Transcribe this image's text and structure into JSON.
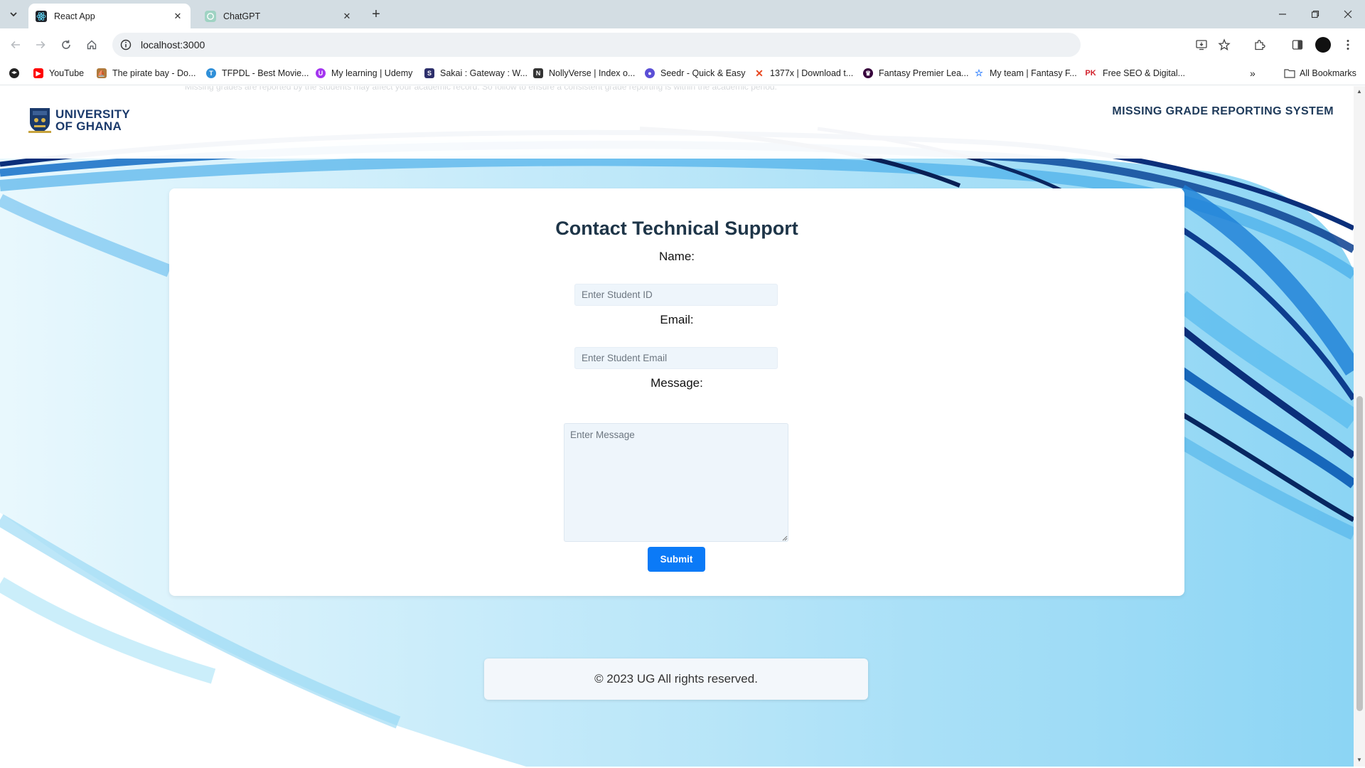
{
  "browser": {
    "tabs": [
      {
        "title": "React App",
        "favicon": "react-icon",
        "active": true
      },
      {
        "title": "ChatGPT",
        "favicon": "chatgpt-icon",
        "active": false
      }
    ],
    "url": "localhost:3000",
    "bookmarks": [
      {
        "label": "YouTube",
        "icon": "youtube-icon",
        "color": "#ff0000"
      },
      {
        "label": "The pirate bay - Do...",
        "icon": "pirate-ship-icon",
        "color": "#b07a3c"
      },
      {
        "label": "TFPDL - Best Movie...",
        "icon": "tfpdl-icon",
        "color": "#2f8fd8"
      },
      {
        "label": "My learning | Udemy",
        "icon": "udemy-icon",
        "color": "#a435f0"
      },
      {
        "label": "Sakai : Gateway : W...",
        "icon": "sakai-icon",
        "color": "#2d2f6b"
      },
      {
        "label": "NollyVerse | Index o...",
        "icon": "nollyverse-icon",
        "color": "#333333"
      },
      {
        "label": "Seedr - Quick & Easy",
        "icon": "seedr-icon",
        "color": "#5b4fd6"
      },
      {
        "label": "1377x | Download t...",
        "icon": "x-icon",
        "color": "#e8471f"
      },
      {
        "label": "Fantasy Premier Lea...",
        "icon": "premier-league-icon",
        "color": "#37003c"
      },
      {
        "label": "My team | Fantasy F...",
        "icon": "fantasy-star-icon",
        "color": "#3a86ff"
      },
      {
        "label": "Free SEO & Digital...",
        "icon": "pk-icon",
        "color": "#d11f2a"
      }
    ],
    "all_bookmarks_label": "All Bookmarks"
  },
  "header": {
    "logo_line1": "UNIVERSITY",
    "logo_line2": "OF GHANA",
    "system_title": "MISSING GRADE REPORTING SYSTEM",
    "ghost_text": "Missing grades are reported by the students may affect your academic record. So follow to ensure a consistent grade reporting is within the academic period."
  },
  "form": {
    "title": "Contact Technical Support",
    "name_label": "Name:",
    "name_placeholder": "Enter Student ID",
    "email_label": "Email:",
    "email_placeholder": "Enter Student Email",
    "message_label": "Message:",
    "message_placeholder": "Enter Message",
    "submit_label": "Submit"
  },
  "footer": {
    "text": "© 2023 UG All rights reserved."
  },
  "colors": {
    "accent": "#0b7af7",
    "heading": "#1e3548",
    "brand": "#1b3a6b"
  }
}
